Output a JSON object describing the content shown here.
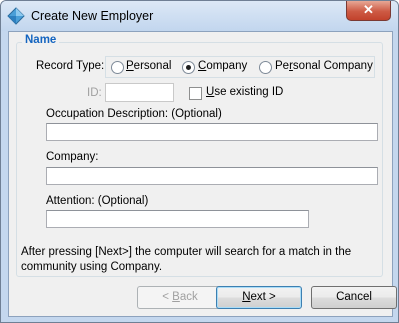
{
  "window": {
    "title": "Create New Employer",
    "close_glyph": "✕"
  },
  "group": {
    "legend": "Name"
  },
  "record_type": {
    "label": "Record Type:",
    "options": [
      {
        "pre": "",
        "u": "P",
        "post": "ersonal",
        "checked": false
      },
      {
        "pre": "",
        "u": "C",
        "post": "ompany",
        "checked": true
      },
      {
        "pre": "Pe",
        "u": "r",
        "post": "sonal Company",
        "checked": false
      }
    ]
  },
  "id_field": {
    "label": "ID:",
    "value": ""
  },
  "use_existing": {
    "u": "U",
    "post": "se existing ID",
    "checked": false
  },
  "fields": {
    "occupation": {
      "label": "Occupation Description: (Optional)",
      "value": ""
    },
    "company": {
      "label": "Company:",
      "value": ""
    },
    "attention": {
      "label": "Attention:  (Optional)",
      "value": ""
    }
  },
  "info": {
    "line1": "After pressing [Next>] the computer will search for a match in the",
    "line2": "community using Company."
  },
  "buttons": {
    "back": {
      "u": "< ",
      "u_char": "B",
      "post": "ack"
    },
    "next": {
      "u_char": "N",
      "post": "ext >"
    },
    "cancel": "Cancel"
  },
  "icons": [
    "app-diamond-icon",
    "close-icon"
  ],
  "colors": {
    "legend": "#1565c0",
    "titlebar": "#c4d7ee",
    "close": "#c7432e"
  }
}
